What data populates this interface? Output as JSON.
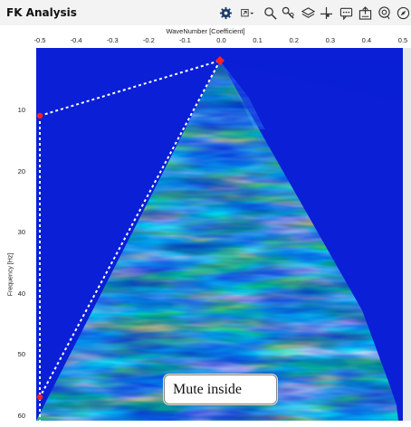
{
  "window": {
    "title": "FK Analysis"
  },
  "toolbar": {
    "icons": [
      "gear-icon",
      "layer-select-icon",
      "zoom-icon",
      "pan-icon",
      "layers-icon",
      "crosshair-icon",
      "comment-icon",
      "export-icon",
      "lasso-icon",
      "compass-icon"
    ]
  },
  "axes": {
    "x_label": "WaveNumber [Coefficient]",
    "x_ticks": [
      "-0.5",
      "-0.4",
      "-0.3",
      "-0.2",
      "-0.1",
      "0.0",
      "0.1",
      "0.2",
      "0.3",
      "0.4",
      "0.5"
    ],
    "y_label": "Frequency [Hz]",
    "y_ticks": [
      "10",
      "20",
      "30",
      "40",
      "50",
      "60"
    ]
  },
  "annotation": {
    "text": "Mute inside"
  },
  "colors": {
    "background_blue": "#0a1fd6",
    "polygon_line": "#ffffff",
    "vertex": "#ff2020"
  }
}
